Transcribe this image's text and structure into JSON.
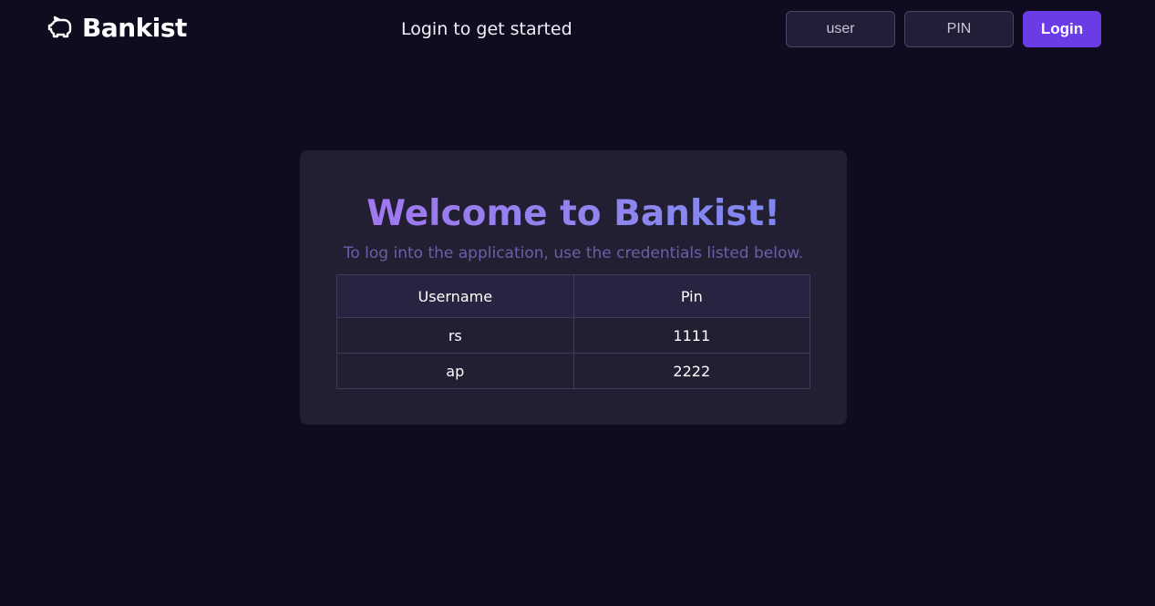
{
  "nav": {
    "logo_icon": "piggy-bank-icon",
    "logo_text": "Bankist",
    "welcome_message": "Login to get started",
    "user_placeholder": "user",
    "pin_placeholder": "PIN",
    "login_label": "Login"
  },
  "card": {
    "title": "Welcome to Bankist!",
    "subtitle": "To log into the application, use the credentials listed below.",
    "table": {
      "headers": [
        "Username",
        "Pin"
      ],
      "rows": [
        [
          "rs",
          "1111"
        ],
        [
          "ap",
          "2222"
        ]
      ]
    }
  },
  "colors": {
    "background": "#0f0c20",
    "card": "#221f33",
    "accent": "#6a3ce6",
    "title_gradient_start": "#a574f0",
    "title_gradient_end": "#7a86f1"
  }
}
